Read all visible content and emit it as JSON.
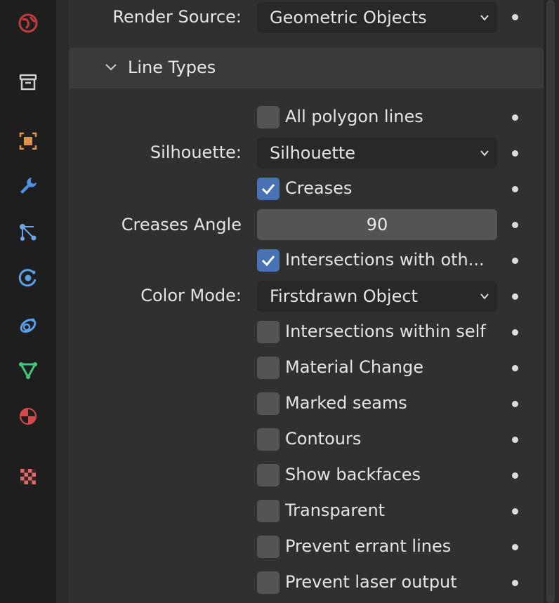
{
  "tabs": [
    {
      "name": "world-icon",
      "color": "#c03c3c"
    },
    {
      "name": "collection-icon",
      "color": "#d0d0d0"
    },
    {
      "name": "object-icon",
      "color": "#e0914a"
    },
    {
      "name": "modifier-icon",
      "color": "#4f8fe8"
    },
    {
      "name": "particles-icon",
      "color": "#6fa6e8"
    },
    {
      "name": "physics-icon",
      "color": "#5aa0e8"
    },
    {
      "name": "constraints-icon",
      "color": "#5aa0e8"
    },
    {
      "name": "data-icon",
      "color": "#42c87a"
    },
    {
      "name": "material-icon",
      "color": "#d84a4a"
    },
    {
      "name": "texture-icon",
      "color": "#d86a6a"
    }
  ],
  "render_source": {
    "label": "Render Source:",
    "value": "Geometric Objects"
  },
  "line_types": {
    "title": "Line Types"
  },
  "all_polygon_lines": {
    "label": "All polygon lines",
    "checked": false
  },
  "silhouette": {
    "label": "Silhouette:",
    "value": "Silhouette"
  },
  "creases": {
    "label": "Creases",
    "checked": true
  },
  "creases_angle": {
    "label": "Creases Angle",
    "value": "90"
  },
  "intersections_with_others": {
    "label": "Intersections with oth...",
    "checked": true
  },
  "color_mode": {
    "label": "Color Mode:",
    "value": "Firstdrawn Object"
  },
  "options": [
    {
      "label": "Intersections within self",
      "checked": false
    },
    {
      "label": "Material Change",
      "checked": false
    },
    {
      "label": "Marked seams",
      "checked": false
    },
    {
      "label": "Contours",
      "checked": false
    },
    {
      "label": "Show backfaces",
      "checked": false
    },
    {
      "label": "Transparent",
      "checked": false
    },
    {
      "label": "Prevent errant lines",
      "checked": false
    },
    {
      "label": "Prevent laser output",
      "checked": false
    }
  ],
  "colors": {
    "accent": "#4772b3",
    "panel": "#303030",
    "field": "#282828"
  }
}
